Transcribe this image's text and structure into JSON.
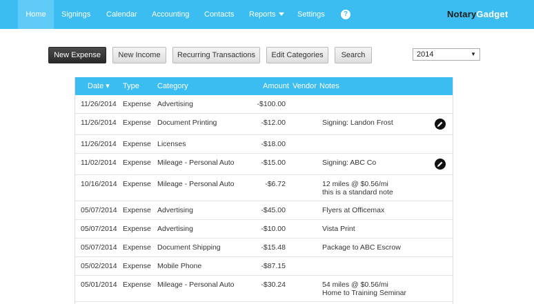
{
  "nav": {
    "home": "Home",
    "signings": "Signings",
    "calendar": "Calendar",
    "accounting": "Accounting",
    "contacts": "Contacts",
    "reports": "Reports",
    "settings": "Settings",
    "help": "?",
    "brand_part1": "Notary",
    "brand_part2": "Gadget",
    "active": "home"
  },
  "toolbar": {
    "new_expense": "New Expense",
    "new_income": "New Income",
    "recurring": "Recurring Transactions",
    "edit_categories": "Edit Categories",
    "search": "Search",
    "year": "2014"
  },
  "table": {
    "headers": {
      "date": "Date ▾",
      "type": "Type",
      "category": "Category",
      "amount": "Amount",
      "vendor": "Vendor",
      "notes": "Notes"
    },
    "rows": [
      {
        "date": "11/26/2014",
        "type": "Expense",
        "category": "Advertising",
        "amount": "-$100.00",
        "notes1": "",
        "notes2": "",
        "edit": false
      },
      {
        "date": "11/26/2014",
        "type": "Expense",
        "category": "Document Printing",
        "amount": "-$12.00",
        "notes1": "Signing: Landon Frost",
        "notes2": "",
        "edit": true
      },
      {
        "date": "11/26/2014",
        "type": "Expense",
        "category": "Licenses",
        "amount": "-$18.00",
        "notes1": "",
        "notes2": "",
        "edit": false
      },
      {
        "date": "11/02/2014",
        "type": "Expense",
        "category": "Mileage - Personal Auto",
        "amount": "-$15.00",
        "notes1": "Signing: ABC Co",
        "notes2": "",
        "edit": true
      },
      {
        "date": "10/16/2014",
        "type": "Expense",
        "category": "Mileage - Personal Auto",
        "amount": "-$6.72",
        "notes1": "12 miles @ $0.56/mi",
        "notes2": "this is a standard note",
        "edit": false
      },
      {
        "date": "05/07/2014",
        "type": "Expense",
        "category": "Advertising",
        "amount": "-$45.00",
        "notes1": "Flyers at Officemax",
        "notes2": "",
        "edit": false
      },
      {
        "date": "05/07/2014",
        "type": "Expense",
        "category": "Advertising",
        "amount": "-$10.00",
        "notes1": "Vista Print",
        "notes2": "",
        "edit": false
      },
      {
        "date": "05/07/2014",
        "type": "Expense",
        "category": "Document Shipping",
        "amount": "-$15.48",
        "notes1": "Package to ABC Escrow",
        "notes2": "",
        "edit": false
      },
      {
        "date": "05/02/2014",
        "type": "Expense",
        "category": "Mobile Phone",
        "amount": "-$87.15",
        "notes1": "",
        "notes2": "",
        "edit": false
      },
      {
        "date": "05/01/2014",
        "type": "Expense",
        "category": "Mileage - Personal Auto",
        "amount": "-$30.24",
        "notes1": "54 miles @ $0.56/mi",
        "notes2": "Home to Training Seminar",
        "edit": false
      }
    ]
  },
  "colors": {
    "nav_bg": "#3bbdf1",
    "header_bg": "#3bbdf1",
    "primary_button": "#333333"
  },
  "icons": {
    "edit": "pencil-icon",
    "help": "help-icon",
    "caret": "chevron-down-icon"
  }
}
